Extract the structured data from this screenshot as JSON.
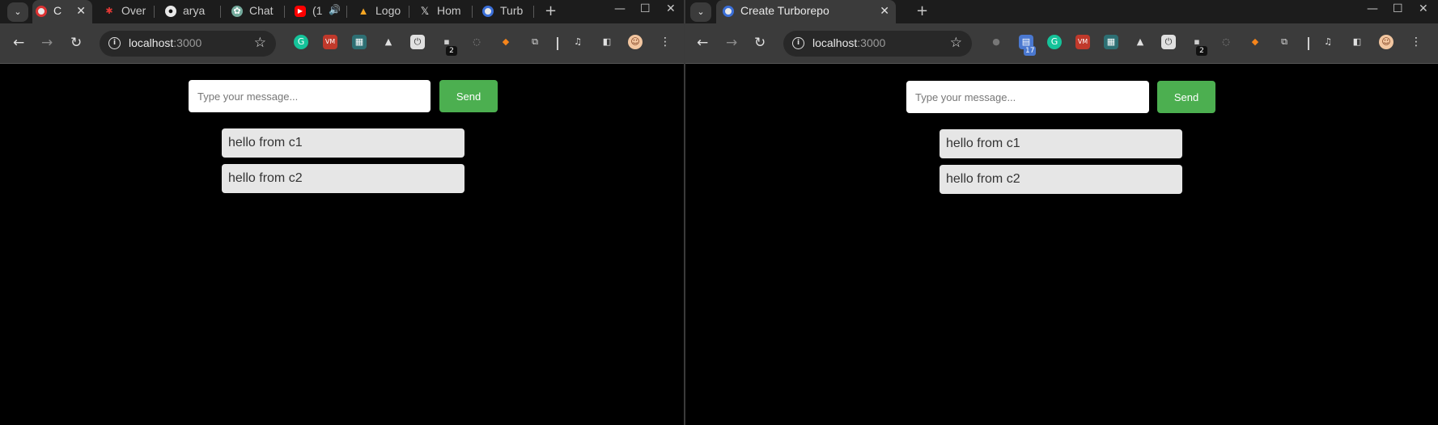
{
  "colors": {
    "accent": "#4caf50",
    "background": "#000000",
    "message_bg": "#e6e6e6",
    "toolbar": "#3b3b3b"
  },
  "left_window": {
    "tabs": [
      {
        "label": "C",
        "icon": "turborepo-icon",
        "active": true
      },
      {
        "label": "Over",
        "icon": "bug-icon"
      },
      {
        "label": "arya",
        "icon": "github-icon"
      },
      {
        "label": "Chat",
        "icon": "chatgpt-icon"
      },
      {
        "label": "(1",
        "icon": "youtube-icon"
      },
      {
        "label": "Logo",
        "icon": "triangle-logo-icon"
      },
      {
        "label": "Hom",
        "icon": "x-icon"
      },
      {
        "label": "Turb",
        "icon": "turborepo-icon"
      }
    ],
    "address": {
      "host": "localhost",
      "port": ":3000"
    },
    "extension_badge": "2",
    "input_placeholder": "Type your message...",
    "send_label": "Send",
    "messages": [
      "hello from c1",
      "hello from c2"
    ]
  },
  "right_window": {
    "tabs": [
      {
        "label": "Create Turborepo",
        "icon": "turborepo-icon",
        "active": true
      }
    ],
    "address": {
      "host": "localhost",
      "port": ":3000"
    },
    "calendar_badge": "17",
    "extension_badge": "2",
    "input_placeholder": "Type your message...",
    "send_label": "Send",
    "messages": [
      "hello from c1",
      "hello from c2"
    ]
  }
}
